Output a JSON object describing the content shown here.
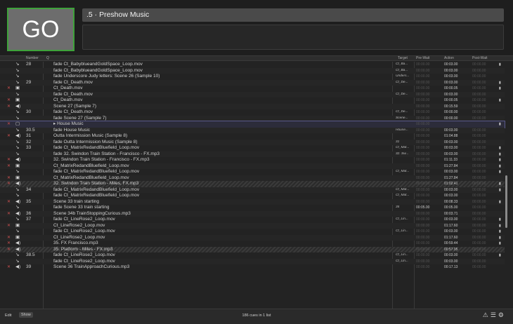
{
  "go_button": {
    "label": "GO"
  },
  "cue_title": ".5 · Preshow Music",
  "header": {
    "number": "Number",
    "q": "Q",
    "target": "Target",
    "pre_wait": "Pre-Wait",
    "action": "Action",
    "post_wait": "Post-Wait"
  },
  "rows": [
    {
      "type": "fade",
      "num": "28",
      "name": "fade Ct_BabyblueandGoldSpace_Loop.mov",
      "target": "Ct_Ba...",
      "pre": "",
      "act": "00:03.00",
      "flag": "▮"
    },
    {
      "type": "fade",
      "num": "",
      "name": "fade Ct_BabyblueandGoldSpace_Loop.mov",
      "target": "Ct_Ba...",
      "pre": "",
      "act": "00:03.00",
      "flag": ""
    },
    {
      "type": "fade",
      "num": "",
      "name": "fade Underscore Judy letters: Scene 26 (Sample 10)",
      "target": "Unders...",
      "pre": "",
      "act": "00:03.00",
      "flag": ""
    },
    {
      "type": "fade",
      "num": "29",
      "name": "fade Ct_Death.mov",
      "target": "Ct_De...",
      "pre": "",
      "act": "00:03.00",
      "flag": "▮"
    },
    {
      "type": "video",
      "num": "",
      "name": "Ct_Death.mov",
      "target": "",
      "pre": "",
      "act": "00:00.05",
      "flag": "▮"
    },
    {
      "type": "fade",
      "num": "",
      "name": "fade Ct_Death.mov",
      "target": "Ct_De...",
      "pre": "",
      "act": "00:03.00",
      "flag": ""
    },
    {
      "type": "video",
      "num": "",
      "name": "Ct_Death.mov",
      "target": "",
      "pre": "",
      "act": "00:00.05",
      "flag": "▮"
    },
    {
      "type": "audio",
      "num": "",
      "name": "Scene 27 (Sample 7)",
      "target": "",
      "pre": "",
      "act": "00:15.59",
      "flag": ""
    },
    {
      "type": "fade",
      "num": "30",
      "name": "fade Ct_Death.mov",
      "target": "Ct_De...",
      "pre": "",
      "act": "00:00.00",
      "flag": ""
    },
    {
      "type": "fade",
      "num": "",
      "name": "fade Scene 27 (Sample 7)",
      "target": "Scene...",
      "pre": "",
      "act": "00:00.00",
      "flag": ""
    },
    {
      "type": "group",
      "num": "",
      "name": "House Music",
      "target": "",
      "pre": "",
      "act": "",
      "flag": "▮"
    },
    {
      "type": "fade",
      "num": "30.5",
      "name": "fade House Music",
      "target": "House...",
      "pre": "",
      "act": "00:03.00",
      "flag": ""
    },
    {
      "type": "audio",
      "num": "31",
      "name": "Outta Intermission Music (Sample 8)",
      "target": "",
      "pre": "",
      "act": "01:04.88",
      "flag": ""
    },
    {
      "type": "fade",
      "num": "32",
      "name": "fade Outta Intermission Music (Sample 8)",
      "target": "31",
      "pre": "",
      "act": "00:03.00",
      "flag": ""
    },
    {
      "type": "fade",
      "num": "33",
      "name": "fade Ct_MatrixRedandBluefield_Loop.mov",
      "target": "Ct_Mat...",
      "pre": "",
      "act": "00:03.00",
      "flag": "▮"
    },
    {
      "type": "fade",
      "num": "",
      "name": "fade 32. Swindon Train Station - Francisco - FX.mp3",
      "target": "32. Sw...",
      "pre": "",
      "act": "00:03.00",
      "flag": "▮"
    },
    {
      "type": "audio",
      "num": "",
      "name": "32. Swindon Train Station - Francisco - FX.mp3",
      "target": "",
      "pre": "",
      "act": "01:11.33",
      "flag": "▮"
    },
    {
      "type": "video",
      "num": "",
      "name": "Ct_MatrixRedandBluefield_Loop.mov",
      "target": "",
      "pre": "",
      "act": "01:27.84",
      "flag": "▮"
    },
    {
      "type": "fade",
      "num": "",
      "name": "fade Ct_MatrixRedandBluefield_Loop.mov",
      "target": "Ct_Mat...",
      "pre": "",
      "act": "00:03.00",
      "flag": "▮"
    },
    {
      "type": "video",
      "num": "",
      "name": "Ct_MatrixRedandBluefield_Loop.mov",
      "target": "",
      "pre": "",
      "act": "01:27.84",
      "flag": ""
    },
    {
      "type": "audio",
      "num": "",
      "name": "32. Swindon Train Station - Miles, FX.mp3",
      "target": "",
      "pre": "",
      "act": "01:02.41",
      "flag": "▮",
      "hatched": true
    },
    {
      "type": "fade",
      "num": "34",
      "name": "fade Ct_MatrixRedandBluefield_Loop.mov",
      "target": "Ct_Mat...",
      "pre": "",
      "act": "00:03.00",
      "flag": "▮"
    },
    {
      "type": "fade",
      "num": "",
      "name": "fade Ct_MatrixRedandBluefield_Loop.mov",
      "target": "Ct_Mat...",
      "pre": "",
      "act": "00:03.00",
      "flag": ""
    },
    {
      "type": "audio",
      "num": "35",
      "name": "Scene 33 train starting",
      "target": "",
      "pre": "",
      "act": "00:08.33",
      "flag": "▮"
    },
    {
      "type": "fade",
      "num": "",
      "name": "fade Scene 33 train starting",
      "target": "35",
      "pre": "00:05.00",
      "act": "00:05.00",
      "flag": ""
    },
    {
      "type": "audio",
      "num": "36",
      "name": "Scene 34b TrainStoppingCurious.mp3",
      "target": "",
      "pre": "",
      "act": "00:03.71",
      "flag": ""
    },
    {
      "type": "fade",
      "num": "37",
      "name": "fade Ct_LineRose2_Loop.mov",
      "target": "Ct_Lin...",
      "pre": "",
      "act": "00:03.00",
      "flag": "▮"
    },
    {
      "type": "video",
      "num": "",
      "name": "Ct_LineRose2_Loop.mov",
      "target": "",
      "pre": "",
      "act": "01:17.60",
      "flag": "▮"
    },
    {
      "type": "fade",
      "num": "",
      "name": "fade Ct_LineRose2_Loop.mov",
      "target": "Ct_Lin...",
      "pre": "",
      "act": "00:03.00",
      "flag": "▮"
    },
    {
      "type": "video",
      "num": "",
      "name": "Ct_LineRose2_Loop.mov",
      "target": "",
      "pre": "",
      "act": "01:17.60",
      "flag": "▮"
    },
    {
      "type": "audio",
      "num": "",
      "name": "35. FX Francisco.mp3",
      "target": "",
      "pre": "",
      "act": "00:59.44",
      "flag": "▮"
    },
    {
      "type": "audio",
      "num": "",
      "name": "35. Platform - Miles - FX.mp3",
      "target": "",
      "pre": "",
      "act": "00:57.95",
      "flag": "",
      "hatched": true
    },
    {
      "type": "fade",
      "num": "38.5",
      "name": "fade Ct_LineRose2_Loop.mov",
      "target": "Ct_Lin...",
      "pre": "",
      "act": "00:03.00",
      "flag": "▮"
    },
    {
      "type": "fade",
      "num": "",
      "name": "fade Ct_LineRose2_Loop.mov",
      "target": "Ct_Lin...",
      "pre": "",
      "act": "00:03.00",
      "flag": ""
    },
    {
      "type": "audio",
      "num": "39",
      "name": "Scene 36 TrainApproachCurious.mp3",
      "target": "",
      "pre": "",
      "act": "00:17.13",
      "flag": ""
    }
  ],
  "icons": {
    "fade": "fade-icon",
    "video": "video-icon",
    "audio": "audio-icon",
    "group": "group-icon",
    "broken": "broken-x-icon"
  },
  "footer": {
    "edit_label": "Edit",
    "show_label": "Show",
    "count_text": "186 cues in 1 list"
  },
  "colors": {
    "go_border": "#3ea23a",
    "broken": "#d05050",
    "group_outline": "#5a5a8a"
  }
}
